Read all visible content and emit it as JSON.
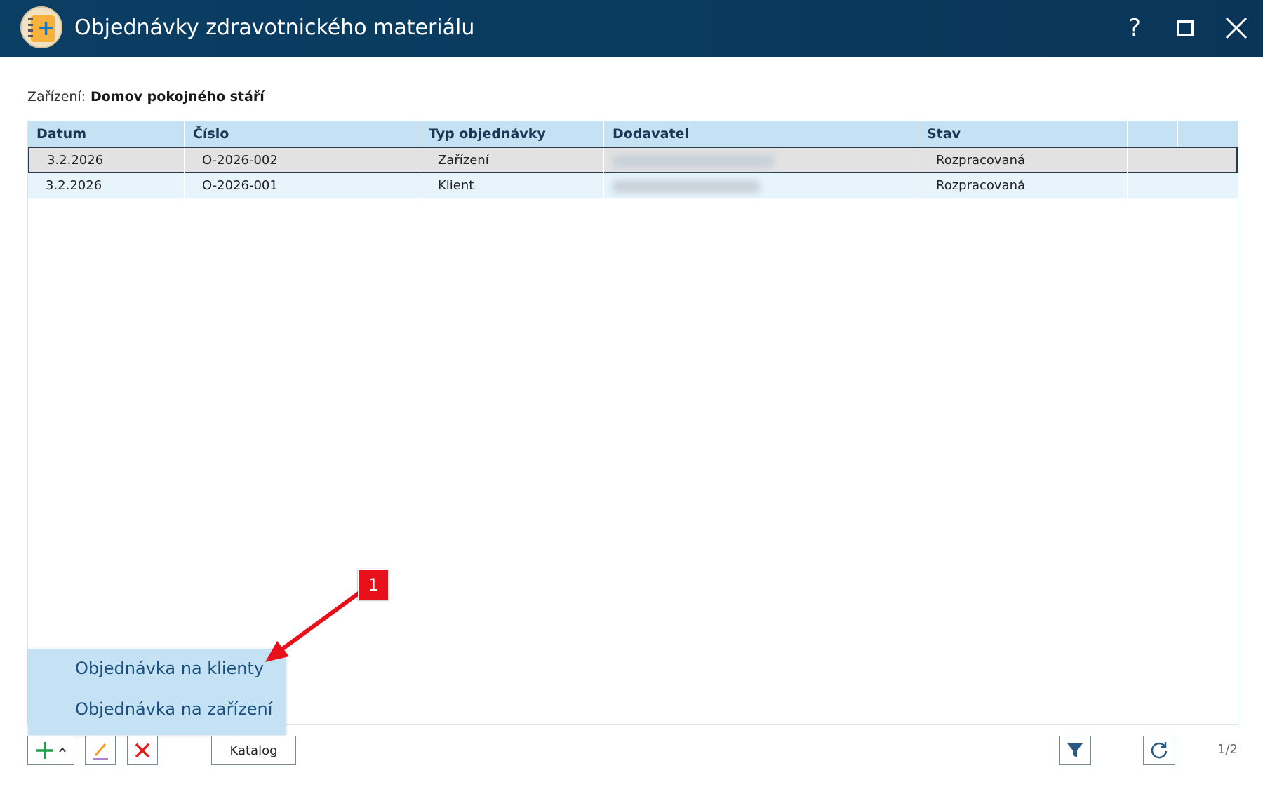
{
  "window": {
    "title": "Objednávky zdravotnického materiálu",
    "help_label": "?"
  },
  "facility": {
    "label": "Zařízení:",
    "value": "Domov pokojného stáří"
  },
  "table": {
    "columns": [
      "Datum",
      "Číslo",
      "Typ objednávky",
      "Dodavatel",
      "Stav"
    ],
    "rows": [
      {
        "datum": "3.2.2026",
        "cislo": "O-2026-002",
        "typ": "Zařízení",
        "dodavatel": "",
        "stav": "Rozpracovaná"
      },
      {
        "datum": "3.2.2026",
        "cislo": "O-2026-001",
        "typ": "Klient",
        "dodavatel": "",
        "stav": "Rozpracovaná"
      }
    ]
  },
  "add_menu": {
    "items": [
      "Objednávka na klienty",
      "Objednávka na zařízení"
    ]
  },
  "annotation": {
    "badge": "1",
    "color": "#e8101a"
  },
  "toolbar": {
    "catalog_label": "Katalog",
    "pager": "1/2"
  },
  "colors": {
    "titlebar": "#0b3e63",
    "header": "#c4e2f4",
    "alt_row": "#e7f4fc",
    "accent_green": "#1e9e4a",
    "delete_red": "#e01c1c"
  }
}
